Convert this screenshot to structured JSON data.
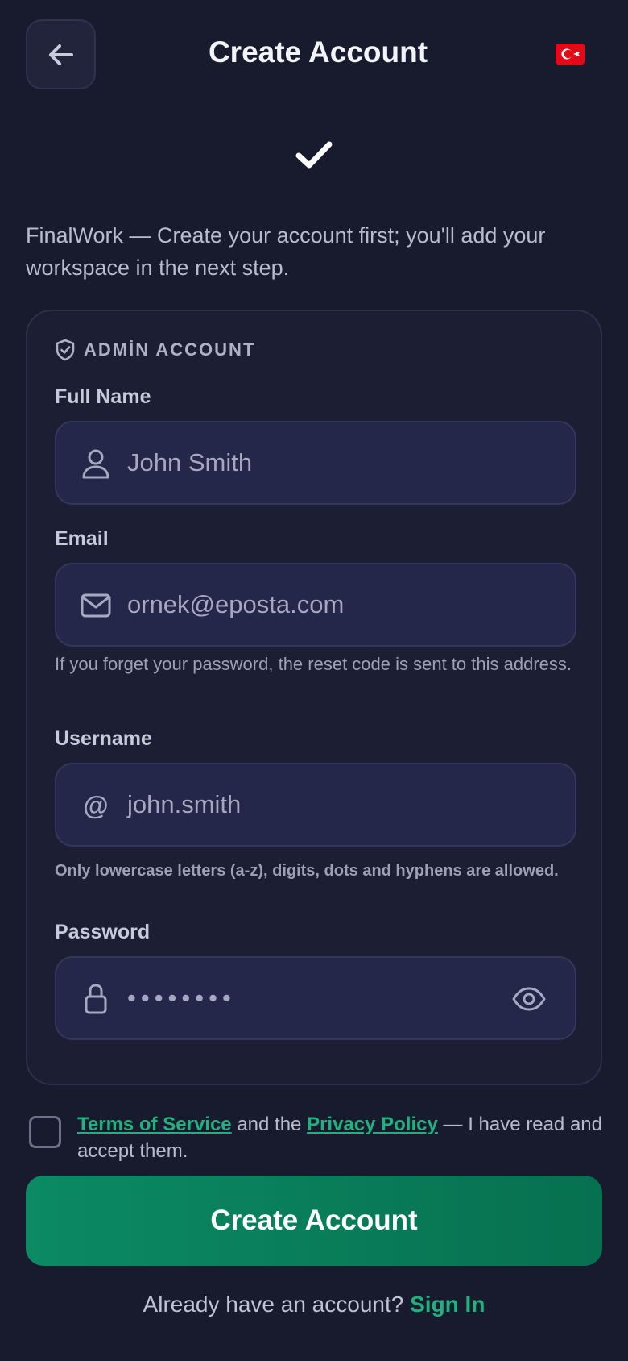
{
  "header": {
    "title": "Create Account",
    "back_icon": "arrow-left-icon",
    "flag_icon": "turkey-flag-icon"
  },
  "intro": "FinalWork — Create your account first; you'll add your workspace in the next step.",
  "card": {
    "section_title": "ADMİN ACCOUNT",
    "section_icon": "shield-check-icon",
    "full_name": {
      "label": "Full Name",
      "placeholder": "John Smith",
      "icon": "user-icon"
    },
    "email": {
      "label": "Email",
      "placeholder": "ornek@eposta.com",
      "icon": "mail-icon",
      "hint": "If you forget your password, the reset code is sent to this address."
    },
    "username": {
      "label": "Username",
      "placeholder": "john.smith",
      "prefix": "@",
      "hint": "Only lowercase letters (a-z), digits, dots and hyphens are allowed."
    },
    "password": {
      "label": "Password",
      "value": "••••••••",
      "icon": "lock-icon",
      "toggle_icon": "eye-icon"
    }
  },
  "terms": {
    "tos": "Terms of Service",
    "and_the": " and the ",
    "privacy": "Privacy Policy",
    "suffix": " — I have read and accept them."
  },
  "submit_label": "Create Account",
  "signin": {
    "prompt": "Already have an account? ",
    "link": "Sign In"
  },
  "colors": {
    "background": "#181a2d",
    "accent": "#1fb27f",
    "button": "#0b8a63"
  }
}
